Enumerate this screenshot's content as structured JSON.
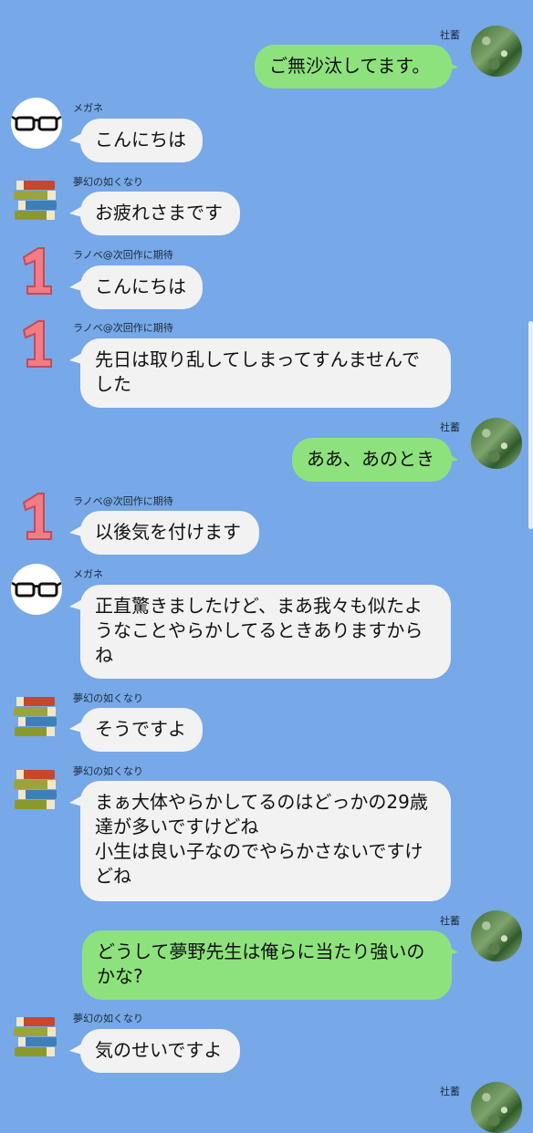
{
  "messages": [
    {
      "side": "right",
      "sender": "社蓄",
      "avatar": "forest-avatar",
      "text": "ご無沙汰してます。"
    },
    {
      "side": "left",
      "sender": "メガネ",
      "avatar": "glasses-avatar",
      "text": "こんにちは"
    },
    {
      "side": "left",
      "sender": "夢幻の如くなり",
      "avatar": "books-avatar",
      "text": "お疲れさまです"
    },
    {
      "side": "left",
      "sender": "ラノベ@次回作に期待",
      "avatar": "number-one-avatar",
      "text": "こんにちは"
    },
    {
      "side": "left",
      "sender": "ラノベ@次回作に期待",
      "avatar": "number-one-avatar",
      "text": "先日は取り乱してしまってすんませんでした"
    },
    {
      "side": "right",
      "sender": "社蓄",
      "avatar": "forest-avatar",
      "text": "ああ、あのとき"
    },
    {
      "side": "left",
      "sender": "ラノベ@次回作に期待",
      "avatar": "number-one-avatar",
      "text": "以後気を付けます"
    },
    {
      "side": "left",
      "sender": "メガネ",
      "avatar": "glasses-avatar",
      "text": "正直驚きましたけど、まあ我々も似たようなことやらかしてるときありますからね"
    },
    {
      "side": "left",
      "sender": "夢幻の如くなり",
      "avatar": "books-avatar",
      "text": "そうですよ"
    },
    {
      "side": "left",
      "sender": "夢幻の如くなり",
      "avatar": "books-avatar",
      "text": "まぁ大体やらかしてるのはどっかの29歳達が多いですけどね\n小生は良い子なのでやらかさないですけどね"
    },
    {
      "side": "right",
      "sender": "社蓄",
      "avatar": "forest-avatar",
      "text": "どうして夢野先生は俺らに当たり強いのかな?"
    },
    {
      "side": "left",
      "sender": "夢幻の如くなり",
      "avatar": "books-avatar",
      "text": "気のせいですよ"
    },
    {
      "side": "right",
      "sender": "社蓄",
      "avatar": "forest-avatar",
      "text": ""
    }
  ],
  "colors": {
    "background": "#77a8e8",
    "incoming_bubble": "#f2f2f3",
    "outgoing_bubble": "#8ee27d"
  }
}
